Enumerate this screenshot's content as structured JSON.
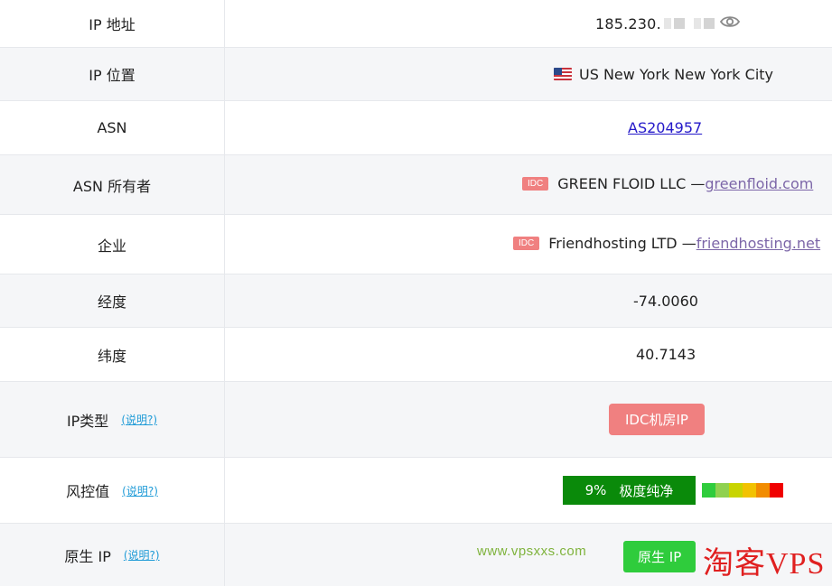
{
  "rows": {
    "ip_address": {
      "label": "IP 地址",
      "value": "185.230."
    },
    "ip_location": {
      "label": "IP 位置",
      "value": "US New York New York City"
    },
    "asn": {
      "label": "ASN",
      "value": "AS204957"
    },
    "asn_owner": {
      "label": "ASN 所有者",
      "badge": "IDC",
      "name": "GREEN FLOID LLC —",
      "link": "greenfloid.com"
    },
    "company": {
      "label": "企业",
      "badge": "IDC",
      "name": "Friendhosting LTD —",
      "link": "friendhosting.net"
    },
    "longitude": {
      "label": "经度",
      "value": "-74.0060"
    },
    "latitude": {
      "label": "纬度",
      "value": "40.7143"
    },
    "ip_type": {
      "label": "IP类型",
      "help": "(说明?)",
      "value": "IDC机房IP"
    },
    "risk": {
      "label": "风控值",
      "help": "(说明?)",
      "percent": "9%",
      "level": "极度纯净",
      "score_fraction": 0.09
    },
    "native_ip": {
      "label": "原生 IP",
      "help": "(说明?)",
      "value": "原生 IP"
    }
  },
  "watermark": {
    "site": "www.vpsxxs.com",
    "brand": "淘客VPS"
  },
  "colors": {
    "idc_badge": "#f08080",
    "risk_good": "#0a8a0a",
    "native_ip": "#2fcc3c",
    "link": "#2419c9",
    "link_visited": "#7c66a8",
    "help_link": "#1f9bd7",
    "risk_scale": [
      "#2fcc3c",
      "#8fd14f",
      "#c8d400",
      "#f2c200",
      "#f28c00",
      "#f00000"
    ]
  },
  "icons": {
    "location_flag": "us-flag-icon",
    "reveal": "eye-icon"
  }
}
